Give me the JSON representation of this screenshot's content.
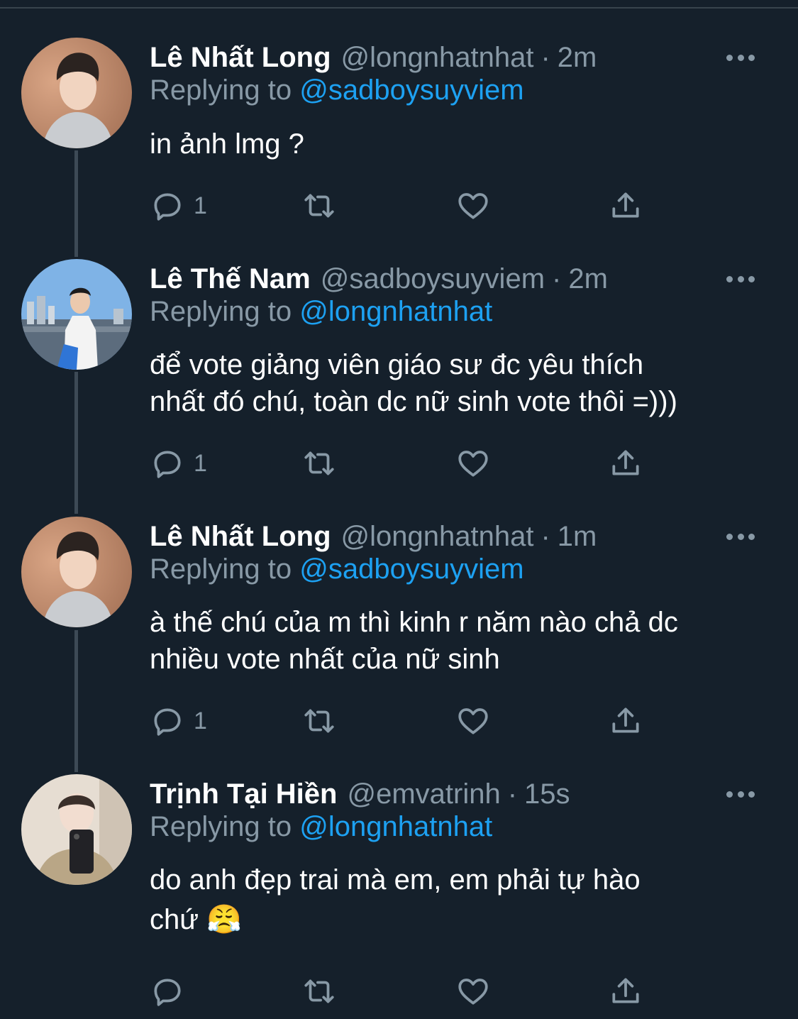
{
  "reply_prefix": "Replying to",
  "tweets": [
    {
      "name": "Lê Nhất Long",
      "handle": "@longnhatnhat",
      "separator": "·",
      "time": "2m",
      "replying_to": "@sadboysuyviem",
      "text_lines": [
        "in ảnh lmg ?"
      ],
      "reply_count": "1",
      "avatar": "avatar-portrait-warm"
    },
    {
      "name": "Lê Thế Nam",
      "handle": "@sadboysuyviem",
      "separator": "·",
      "time": "2m",
      "replying_to": "@longnhatnhat",
      "text_lines": [
        "để vote giảng viên giáo sư đc yêu thích",
        "nhất đó chú, toàn dc nữ sinh vote thôi =)))"
      ],
      "reply_count": "1",
      "avatar": "avatar-city-waterfront"
    },
    {
      "name": "Lê Nhất Long",
      "handle": "@longnhatnhat",
      "separator": "·",
      "time": "1m",
      "replying_to": "@sadboysuyviem",
      "text_lines": [
        "à thế chú của m thì kinh r năm nào chả dc",
        "nhiều vote nhất của nữ sinh"
      ],
      "reply_count": "1",
      "avatar": "avatar-portrait-warm"
    },
    {
      "name": "Trịnh Tại Hiền",
      "handle": "@emvatrinh",
      "separator": "·",
      "time": "15s",
      "replying_to": "@longnhatnhat",
      "text_lines": [
        "do anh đẹp trai mà em, em phải tự hào",
        "chứ 😤"
      ],
      "reply_count": "",
      "avatar": "avatar-mirror-selfie"
    }
  ],
  "colors": {
    "background": "#15202b",
    "secondary_text": "#8899a6",
    "link": "#1da1f2",
    "thread_line": "#3d4a56"
  }
}
